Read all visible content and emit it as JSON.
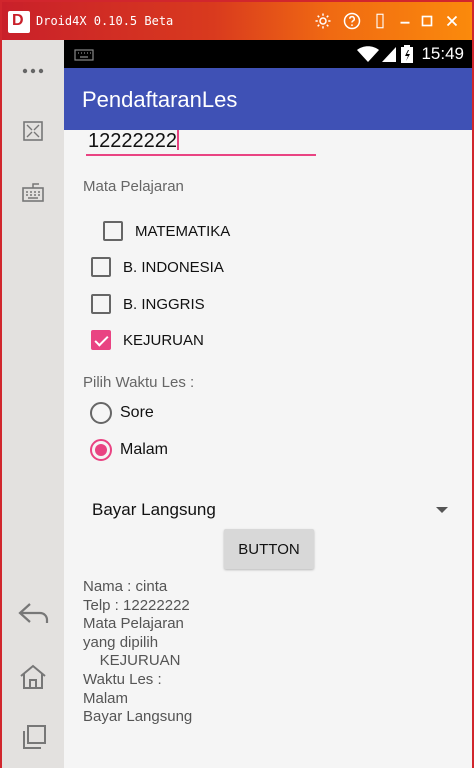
{
  "window": {
    "title": "Droid4X 0.10.5 Beta",
    "controls": [
      "settings-icon",
      "help-icon",
      "restore-icon",
      "minimize-icon",
      "maximize-icon",
      "close-icon"
    ]
  },
  "sidebar": {
    "items": [
      "more-icon",
      "fullscreen-icon",
      "keyboard-icon",
      "back-icon",
      "home-icon",
      "recents-icon"
    ]
  },
  "statusbar": {
    "time": "15:49",
    "icons": [
      "keyboard-icon",
      "wifi-icon",
      "signal-icon",
      "battery-icon"
    ]
  },
  "app": {
    "title": "PendaftaranLes"
  },
  "form": {
    "phone_value": "12222222",
    "subjects_label": "Mata Pelajaran",
    "subjects": [
      {
        "label": "MATEMATIKA",
        "checked": false
      },
      {
        "label": "B. INDONESIA",
        "checked": false
      },
      {
        "label": "B. INGGRIS",
        "checked": false
      },
      {
        "label": "KEJURUAN",
        "checked": true
      }
    ],
    "time_label": "Pilih Waktu Les :",
    "times": [
      {
        "label": "Sore",
        "checked": false
      },
      {
        "label": "Malam",
        "checked": true
      }
    ],
    "payment_selected": "Bayar Langsung",
    "button_label": "BUTTON"
  },
  "result": {
    "lines": [
      "Nama : cinta",
      "Telp : 12222222",
      "Mata Pelajaran",
      "yang dipilih",
      "    KEJURUAN",
      "Waktu Les :",
      "Malam",
      "Bayar Langsung"
    ]
  },
  "colors": {
    "titlebar_start": "#c9202a",
    "titlebar_end": "#fb8a0c",
    "appbar": "#3f51b5",
    "accent": "#e94382"
  }
}
